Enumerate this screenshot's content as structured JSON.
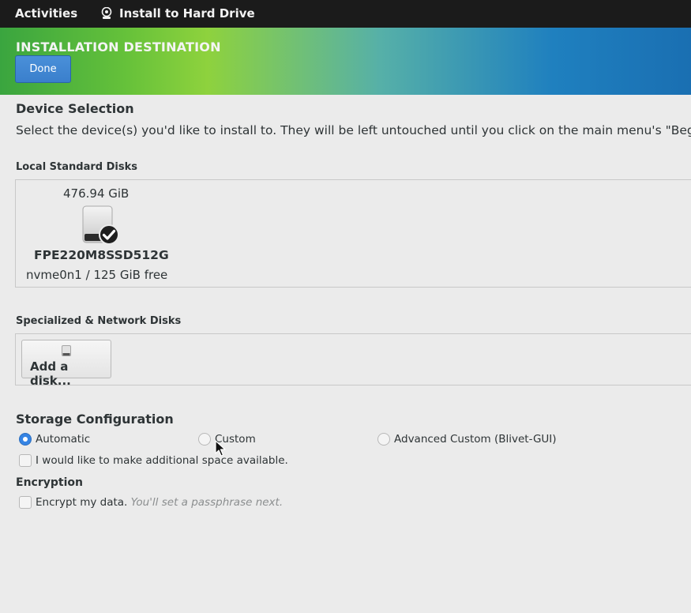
{
  "topbar": {
    "activities": "Activities",
    "app_title": "Install to Hard Drive",
    "app_icon": "anaconda-installer-icon"
  },
  "header": {
    "title": "INSTALLATION DESTINATION",
    "done_label": "Done"
  },
  "device_selection": {
    "title": "Device Selection",
    "description": "Select the device(s) you'd like to install to.  They will be left untouched until you click on the main menu's \"Begin"
  },
  "local_disks": {
    "title": "Local Standard Disks",
    "disk": {
      "size": "476.94 GiB",
      "icon": "hard-disk-selected-icon",
      "model": "FPE220M8SSD512G",
      "name": "nvme0n1",
      "separator": "/",
      "free": "125 GiB free"
    }
  },
  "network_disks": {
    "title": "Specialized & Network Disks",
    "add_label": "Add a disk..."
  },
  "storage": {
    "title": "Storage Configuration",
    "options": {
      "automatic": "Automatic",
      "custom": "Custom",
      "advanced": "Advanced Custom (Blivet-GUI)"
    },
    "selected": "Automatic",
    "space_label": "I would like to make additional space available."
  },
  "encryption": {
    "title": "Encryption",
    "label": "Encrypt my data.",
    "hint": "You'll set a passphrase next."
  },
  "colors": {
    "accent": "#3584e4",
    "topbar": "#1b1b1b",
    "background": "#ebebeb"
  }
}
